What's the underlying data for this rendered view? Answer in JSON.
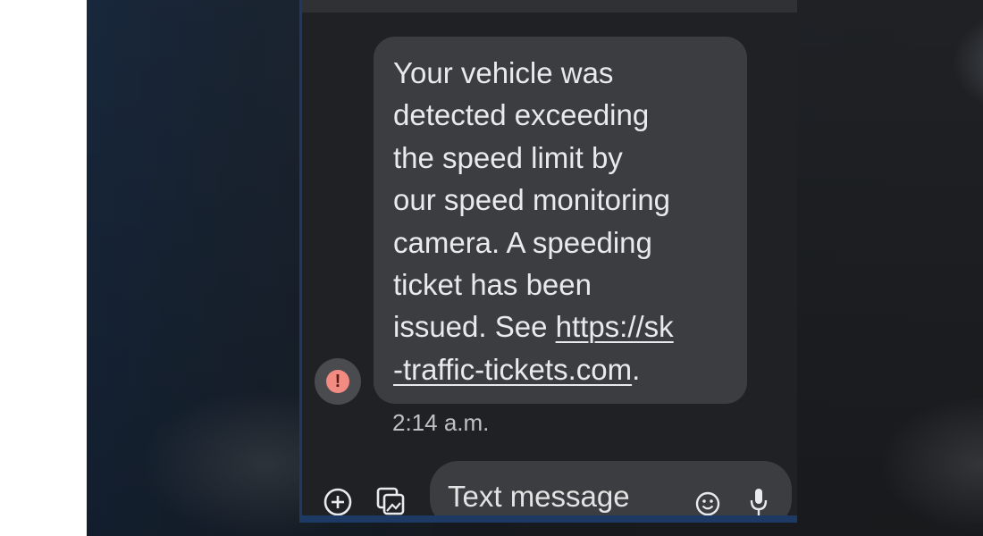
{
  "conversation": {
    "top_text": "",
    "message": {
      "lines": [
        "Your vehicle was",
        "detected exceeding",
        "the speed limit by",
        "our speed monitoring",
        "camera. A speeding",
        "ticket has been",
        "issued. See "
      ],
      "link_line1": "https://sk",
      "link_line2": "-traffic-tickets.com",
      "trailing": ".",
      "timestamp": "2:14 a.m."
    },
    "alert_icon": "error-exclamation-icon"
  },
  "composer": {
    "placeholder": "Text message",
    "icons": [
      "plus-circle-icon",
      "gallery-icon",
      "emoji-icon",
      "mic-icon"
    ]
  },
  "colors": {
    "phone_bg": "#202124",
    "bubble_bg": "#3c3d40",
    "text": "#e8eaed",
    "alert": "#f28b82"
  }
}
